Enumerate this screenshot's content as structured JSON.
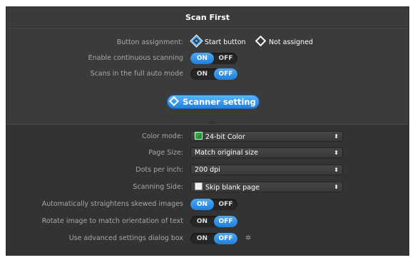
{
  "window": {
    "title": "Scan First"
  },
  "rows": {
    "button_assignment": {
      "label": "Button assignment:",
      "options": [
        "Start button",
        "Not assigned"
      ],
      "selected": "Start button"
    },
    "continuous": {
      "label": "Enable continuous scanning",
      "on": "ON",
      "off": "OFF",
      "state": "ON"
    },
    "full_auto": {
      "label": "Scans in the full auto mode",
      "on": "ON",
      "off": "OFF",
      "state": "OFF"
    }
  },
  "scanner_setting": {
    "label": "Scanner setting"
  },
  "settings": {
    "color_mode": {
      "label": "Color mode:",
      "value": "24-bit Color",
      "icon": "color-image-icon"
    },
    "page_size": {
      "label": "Page Size:",
      "value": "Match original size"
    },
    "dpi": {
      "label": "Dots per inch:",
      "value": "200 dpi"
    },
    "scanning_side": {
      "label": "Scanning Side:",
      "value": "Skip blank page",
      "icon": "page-icon"
    },
    "deskew": {
      "label": "Automatically straightens skewed images",
      "on": "ON",
      "off": "OFF",
      "state": "ON"
    },
    "rotate": {
      "label": "Rotate image to match orientation of text",
      "on": "ON",
      "off": "OFF",
      "state": "OFF"
    },
    "advanced": {
      "label": "Use advanced settings dialog box",
      "on": "ON",
      "off": "OFF",
      "state": "OFF",
      "extra_icon": "gear-icon"
    }
  },
  "colors": {
    "accent": "#1f7fdc",
    "background": "#3b3b3b",
    "panel": "#333333",
    "label": "#a8a8a8"
  }
}
